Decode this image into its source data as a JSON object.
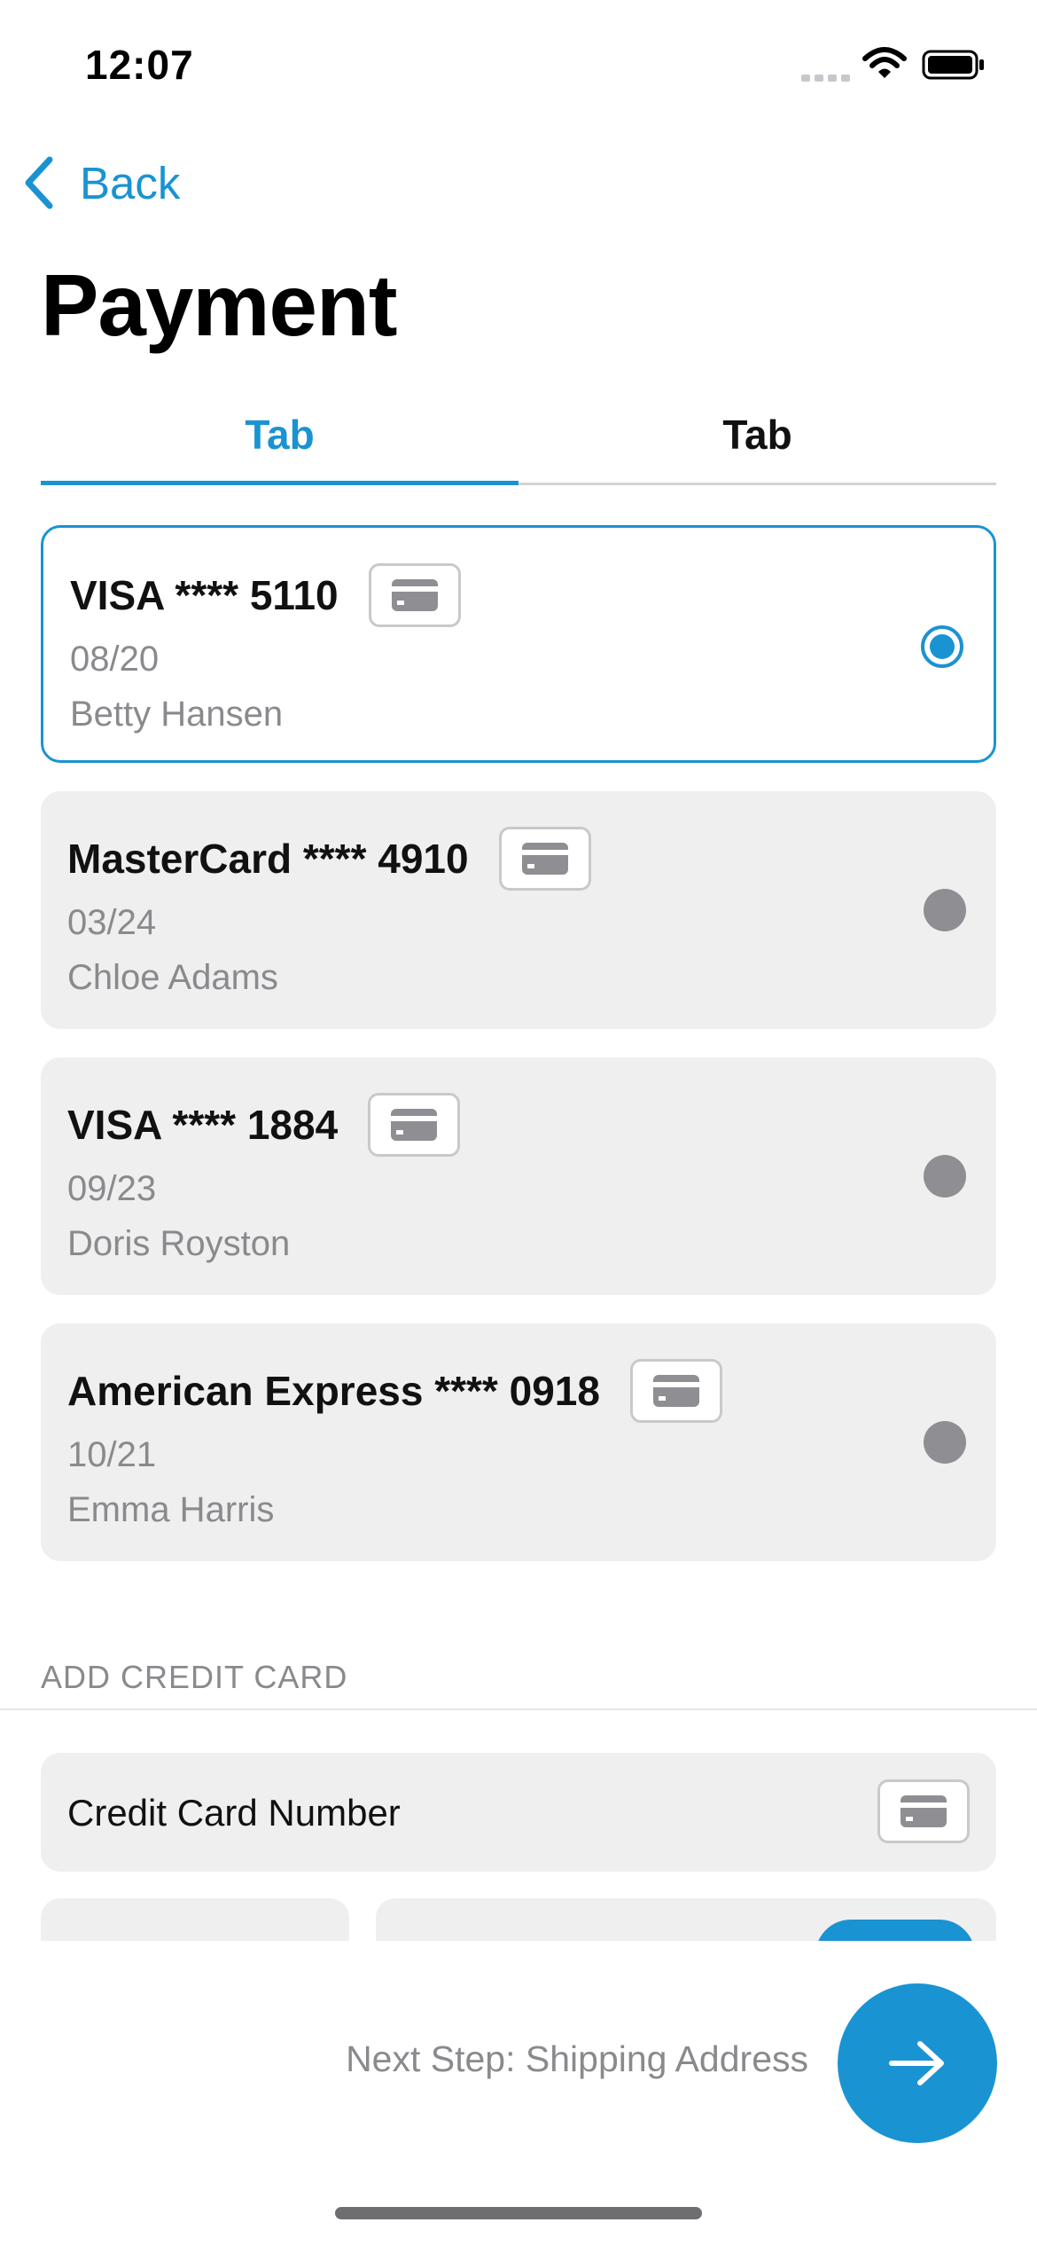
{
  "status_bar": {
    "time": "12:07"
  },
  "nav": {
    "back_label": "Back"
  },
  "page": {
    "title": "Payment"
  },
  "tabs": [
    {
      "label": "Tab",
      "active": true
    },
    {
      "label": "Tab",
      "active": false
    }
  ],
  "cards": [
    {
      "title": "VISA **** 5110",
      "expiry": "08/20",
      "holder": "Betty Hansen",
      "selected": true
    },
    {
      "title": "MasterCard **** 4910",
      "expiry": "03/24",
      "holder": "Chloe Adams",
      "selected": false
    },
    {
      "title": "VISA **** 1884",
      "expiry": "09/23",
      "holder": "Doris Royston",
      "selected": false
    },
    {
      "title": "American Express **** 0918",
      "expiry": "10/21",
      "holder": "Emma Harris",
      "selected": false
    }
  ],
  "add_card": {
    "section_header": "ADD CREDIT CARD",
    "number_placeholder": "Credit Card Number"
  },
  "footer": {
    "next_label": "Next Step: Shipping Address"
  },
  "colors": {
    "accent": "#1a93d2",
    "card_bg": "#efefef",
    "secondary_text": "#8a8a8e"
  },
  "icons": [
    "back-chevron-icon",
    "credit-card-icon",
    "arrow-right-icon",
    "wifi-icon",
    "battery-icon",
    "signal-icon"
  ]
}
